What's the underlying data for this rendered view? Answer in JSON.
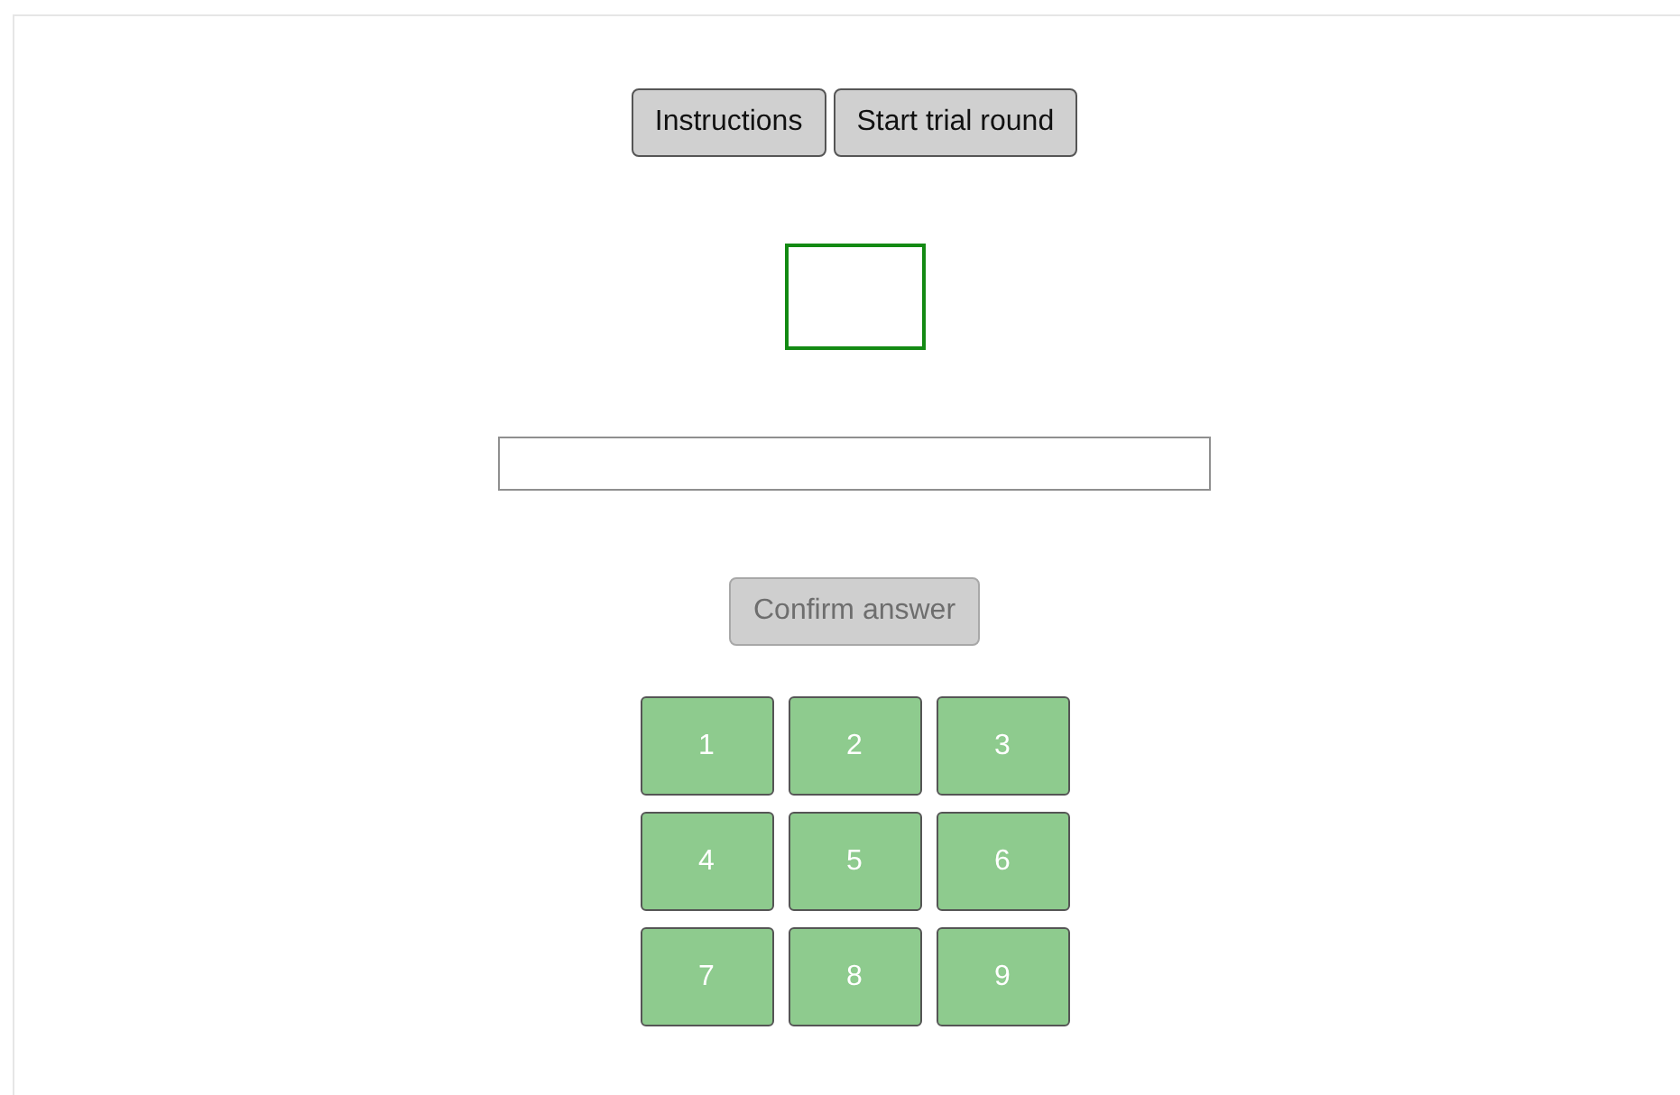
{
  "toolbar": [
    {
      "label": "Instructions"
    },
    {
      "label": "Start trial round"
    }
  ],
  "confirm_button": {
    "label": "Confirm answer",
    "disabled": true
  },
  "keypad": [
    {
      "label": "1"
    },
    {
      "label": "2"
    },
    {
      "label": "3"
    },
    {
      "label": "4"
    },
    {
      "label": "5"
    },
    {
      "label": "6"
    },
    {
      "label": "7"
    },
    {
      "label": "8"
    },
    {
      "label": "9"
    }
  ]
}
